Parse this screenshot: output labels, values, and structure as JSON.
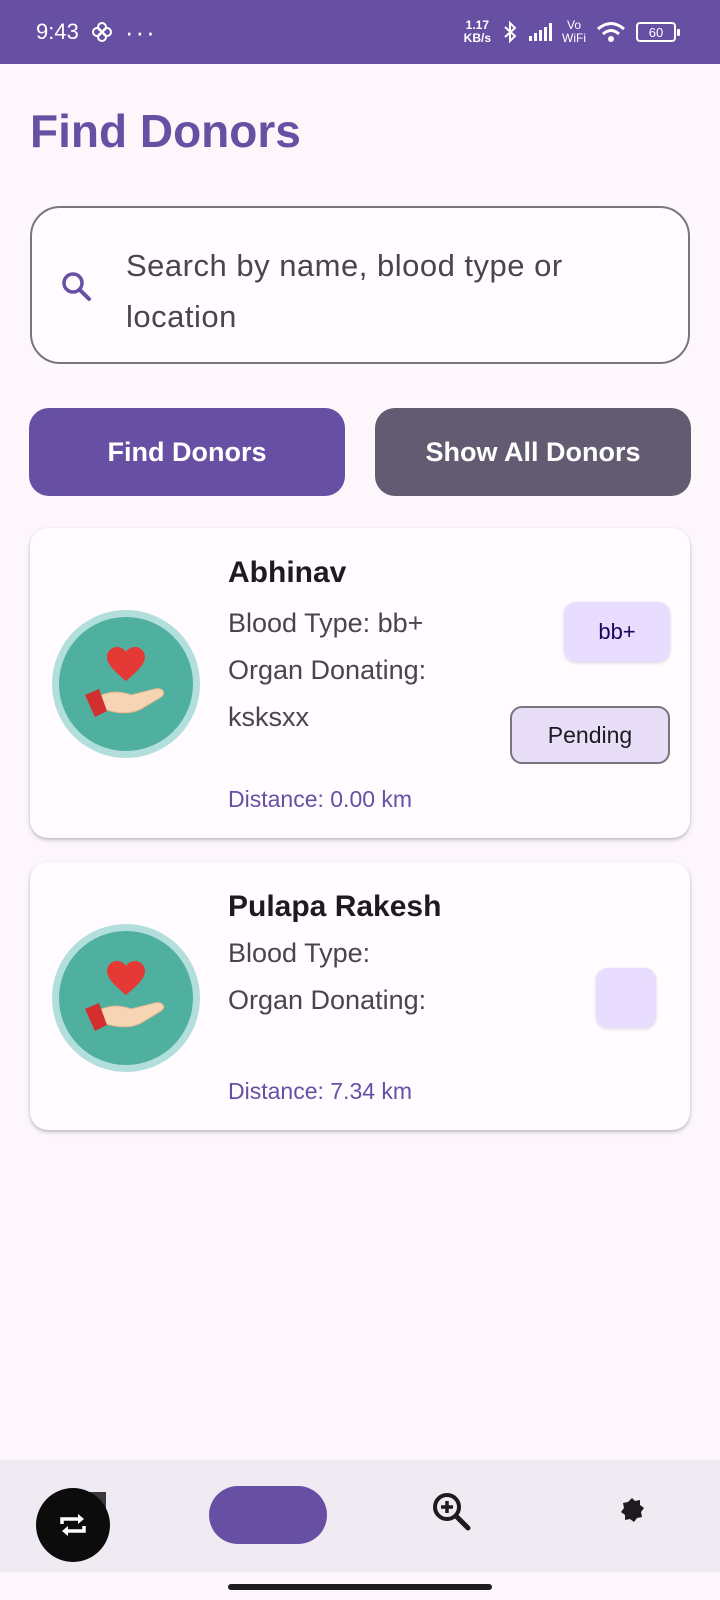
{
  "status_bar": {
    "time": "9:43",
    "dots": "···",
    "net_speed_value": "1.17",
    "net_speed_unit": "KB/s",
    "vo": "Vo",
    "wifi_label": "WiFi",
    "battery": "60"
  },
  "page": {
    "title": "Find Donors"
  },
  "search": {
    "placeholder": "Search by name, blood type or location",
    "value": ""
  },
  "buttons": {
    "find": "Find Donors",
    "show_all": "Show All Donors"
  },
  "donors": [
    {
      "name": "Abhinav",
      "blood_type_line": "Blood Type: bb+",
      "organ_line": "Organ Donating: ksksxx",
      "distance": "Distance: 0.00 km",
      "blood_chip": "bb+",
      "status": "Pending"
    },
    {
      "name": "Pulapa Rakesh",
      "blood_type_line": "Blood Type:",
      "organ_line": "Organ Donating:",
      "distance": "Distance: 7.34 km",
      "blood_chip": ""
    }
  ],
  "colors": {
    "primary": "#6750a4",
    "secondary": "#625b71",
    "avatar_ring": "#b2dfdb",
    "avatar_fill": "#4fb0a0",
    "heart": "#e53935",
    "chip": "#e8ddff"
  },
  "icons": {
    "search": "search-icon",
    "donor_avatar": "hand-heart-icon",
    "fab": "repeat-icon",
    "nav_zoom": "zoom-in-icon",
    "nav_settings": "settings-icon",
    "status_bluetooth": "bluetooth-icon",
    "status_wifi": "wifi-icon"
  }
}
